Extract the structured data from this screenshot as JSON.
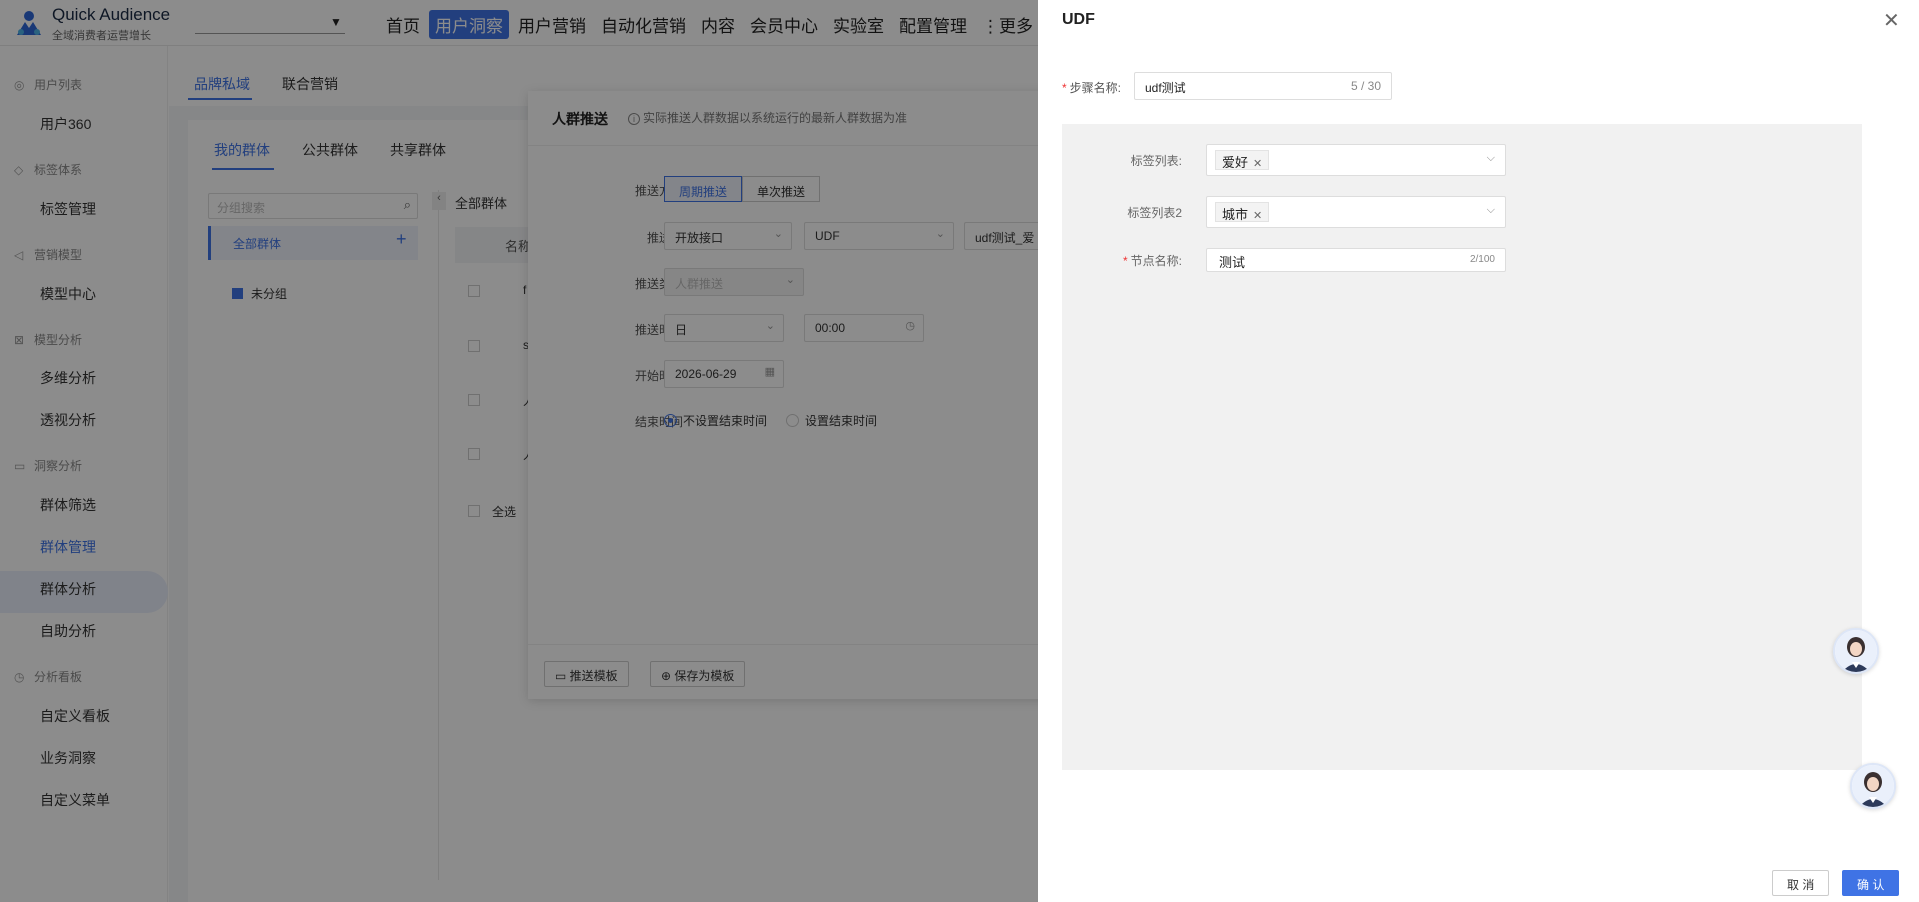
{
  "app": {
    "title": "Quick Audience",
    "subtitle": "全域消费者运营增长"
  },
  "topnav": [
    "首页",
    "用户洞察",
    "用户营销",
    "自动化营销",
    "内容",
    "会员中心",
    "实验室",
    "配置管理",
    "更多"
  ],
  "sidebar": {
    "groups": [
      "用户列表",
      "标签体系",
      "营销模型",
      "模型分析",
      "洞察分析",
      "分析看板"
    ],
    "items": [
      "用户360",
      "标签管理",
      "模型中心",
      "多维分析",
      "透视分析",
      "群体筛选",
      "群体管理",
      "群体分析",
      "自助分析",
      "自定义看板",
      "业务洞察",
      "自定义菜单"
    ]
  },
  "main_tabs": [
    "品牌私域",
    "联合营销"
  ],
  "sub_tabs": [
    "我的群体",
    "公共群体",
    "共享群体"
  ],
  "group_search_placeholder": "分组搜索",
  "tree": {
    "all": "全部群体",
    "ungrouped": "未分组"
  },
  "list": {
    "title": "全部群体",
    "header": "名称",
    "select_all": "全选",
    "row_initials": [
      "f",
      "s",
      "人",
      "人"
    ]
  },
  "push_dialog": {
    "title": "人群推送",
    "tip": "实际推送人群数据以系统运行的最新人群数据为准",
    "labels": {
      "mode": "推送方式",
      "target": "推送至",
      "type": "推送类型",
      "time": "推送时间",
      "start": "开始时间",
      "end": "结束时间"
    },
    "mode_options": [
      "周期推送",
      "单次推送"
    ],
    "target_values": [
      "开放接口",
      "UDF",
      "udf测试_爱"
    ],
    "type_value": "人群推送",
    "time_unit": "日",
    "time_value": "00:00",
    "start_date": "2026-06-29",
    "end_options": [
      "不设置结束时间",
      "设置结束时间"
    ],
    "footer_buttons": [
      "推送模板",
      "保存为模板"
    ]
  },
  "udf_drawer": {
    "title": "UDF",
    "step_name_label": "步骤名称:",
    "step_name_value": "udf测试",
    "step_name_count": "5 / 30",
    "tag_list_label": "标签列表:",
    "tag_list_value": "爱好",
    "tag_list2_label": "标签列表2",
    "tag_list2_value": "城市",
    "node_name_label": "节点名称:",
    "node_name_value": "测试",
    "node_name_count": "2/100",
    "cancel": "取 消",
    "confirm": "确 认"
  },
  "colors": {
    "primary": "#3f73e5",
    "mask": "rgba(0,0,0,0.45)",
    "panel_gray": "#f1f1f1"
  }
}
